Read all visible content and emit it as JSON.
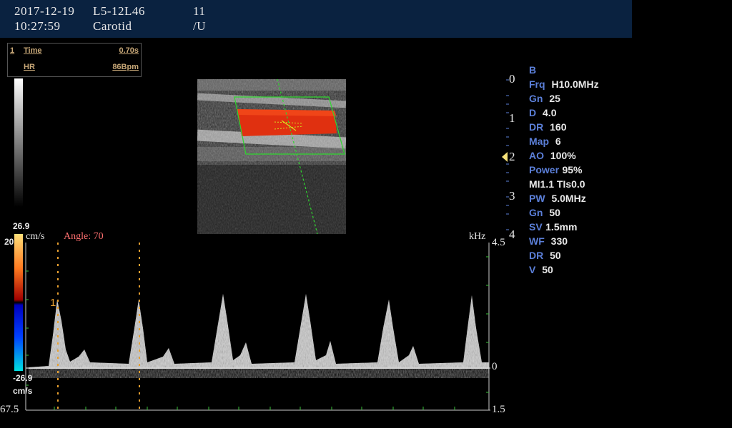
{
  "header": {
    "date": "2017-12-19",
    "probe": "L5-12L46",
    "num": "11",
    "time": "10:27:59",
    "preset": "Carotid",
    "unit": "/U"
  },
  "measurements": {
    "index": "1",
    "time_label": "Time",
    "time_value": "0.70s",
    "hr_label": "HR",
    "hr_value": "86Bpm"
  },
  "color_scale": {
    "top": "26.9",
    "bottom": "-26.9",
    "unit": "cm/s"
  },
  "depth_scale": [
    "0",
    "1",
    "2",
    "3",
    "4"
  ],
  "params": [
    {
      "label": "B",
      "value": ""
    },
    {
      "label": "Frq",
      "value": "H10.0MHz"
    },
    {
      "label": "Gn",
      "value": "25"
    },
    {
      "label": "D",
      "value": "4.0"
    },
    {
      "label": "DR",
      "value": "160"
    },
    {
      "label": "Map",
      "value": "6"
    },
    {
      "label": "AO",
      "value": "100%"
    },
    {
      "label": "Power",
      "value": "95%"
    },
    {
      "label": "",
      "value": "MI1.1 TIs0.0"
    },
    {
      "label": "PW",
      "value": "5.0MHz"
    },
    {
      "label": "Gn",
      "value": "50"
    },
    {
      "label": "SV",
      "value": "1.5mm"
    },
    {
      "label": "WF",
      "value": "330"
    },
    {
      "label": "DR",
      "value": "50"
    },
    {
      "label": "V",
      "value": "50"
    }
  ],
  "spectral": {
    "left_unit": "cm/s",
    "angle_label": "Angle: 70",
    "right_unit": "kHz",
    "left_top": "20",
    "left_bottom": "67.5",
    "right_top": "4.5",
    "right_zero": "0",
    "right_bottom": "1.5",
    "marker_label": "1"
  },
  "colors": {
    "header_bg": "#0a2240",
    "param_label": "#5b7fd8",
    "angle_text": "#ff7070",
    "caliper": "#e8a030",
    "roi_box": "#2fd82f",
    "flow_red": "#e03010"
  }
}
